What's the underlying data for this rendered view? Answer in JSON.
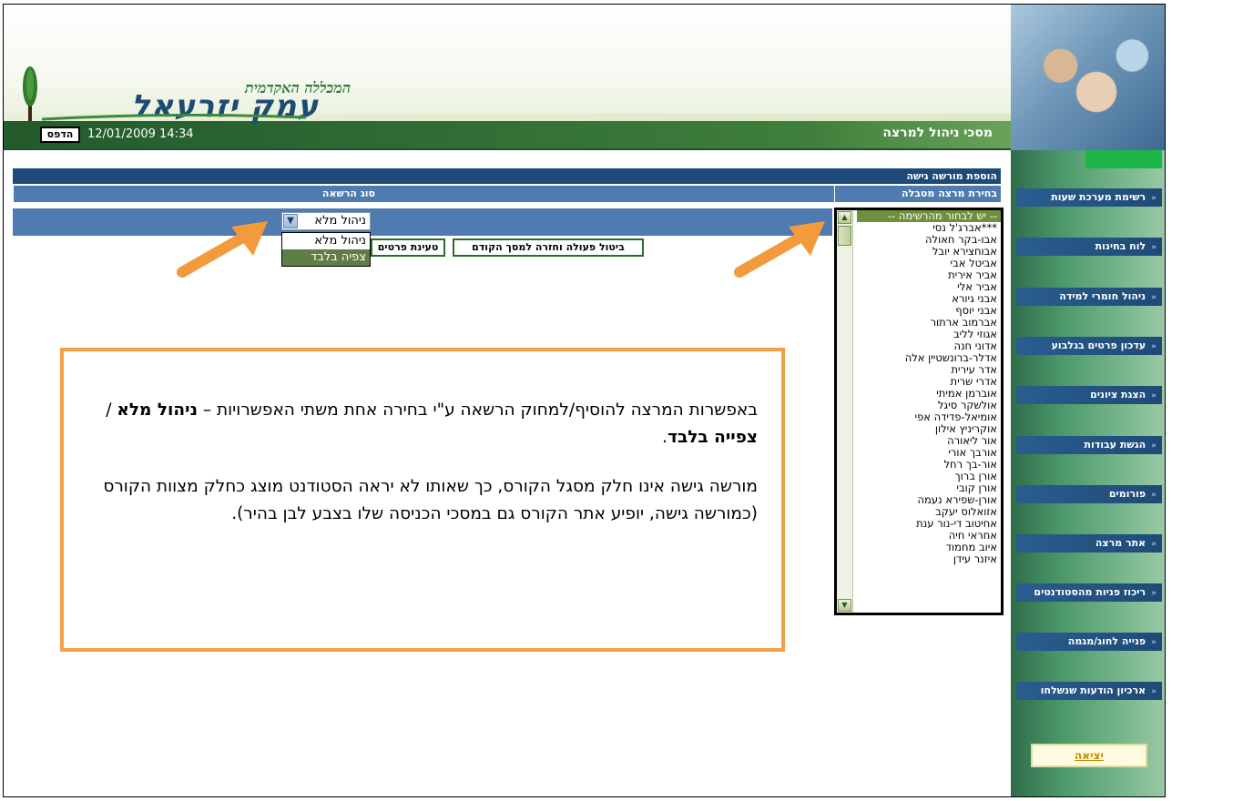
{
  "header": {
    "logo_subtitle": "המכללה האקדמית",
    "logo_title": "עמק יזרעאל",
    "print_label": "הדפס",
    "datetime": "12/01/2009 14:34",
    "page_title": "מסכי ניהול למרצה"
  },
  "content": {
    "section_add": "הוספת מורשה גישה",
    "label_lecturer": "בחירת מרצה מטבלה",
    "label_perm": "סוג הרשאה",
    "perm_selected": "ניהול מלא",
    "perm_options": [
      "ניהול מלא",
      "צפיה בלבד"
    ],
    "btn_load": "טעינת פרטים",
    "btn_cancel": "ביטול פעולה וחזרה למסך הקודם"
  },
  "lecturers": [
    "-- יש לבחור מהרשימה --",
    "***אברג'ל נסי",
    "אבו-בקר חאולה",
    "אבוחצירא יובל",
    "אביטל אבי",
    "אביר אירית",
    "אביר אלי",
    "אבני גיורא",
    "אבני יוסף",
    "אברמוב ארתור",
    "אגוזי לליב",
    "אדוני חנה",
    "אדלר-ברונשטיין אלה",
    "אדר עירית",
    "אדרי שרית",
    "אוברמן אמיתי",
    "אולשקר סיגל",
    "אומיאל-פדידה אפי",
    "אוקריניץ אילון",
    "אור ליאורה",
    "אורבך אורי",
    "אור-בך רחל",
    "אורן ברוך",
    "אורן קובי",
    "אורן-שפירא נעמה",
    "אזואלוס יעקב",
    "אחיטוב די-נור ענת",
    "אחראי חיה",
    "איוב מחמוד",
    "איזנר עידן"
  ],
  "callout": {
    "p1_start": "באפשרות המרצה להוסיף/למחוק הרשאה ע\"י בחירה אחת משתי האפשרויות – ",
    "p1_opt1": "ניהול מלא",
    "p1_sep": " / ",
    "p1_opt2": "צפייה בלבד",
    "p1_end": ".",
    "p2": "מורשה גישה אינו חלק מסגל הקורס, כך שאותו לא יראה הסטודנט מוצג כחלק מצוות הקורס (כמורשה גישה, יופיע אתר הקורס גם במסכי הכניסה שלו בצבע לבן בהיר)."
  },
  "nav": {
    "items": [
      "רשימת מערכת שעות",
      "לוח בחינות",
      "ניהול חומרי למידה",
      "עדכון פרטים בגלבוע",
      "הצגת ציונים",
      "הגשת עבודות",
      "פורומים",
      "אתר מרצה",
      "ריכוז פניות מהסטודנטים",
      "פנייה לחוג/מגמה",
      "ארכיון הודעות שנשלחו"
    ],
    "exit_label": "יציאה"
  },
  "colors": {
    "header_green": "#245a2c",
    "section_blue": "#1d4a78",
    "row_blue": "#4f7bb0",
    "callout_border": "#f3a04a",
    "arrow_orange": "#f39a3c",
    "list_highlight": "#6f8f3c"
  }
}
